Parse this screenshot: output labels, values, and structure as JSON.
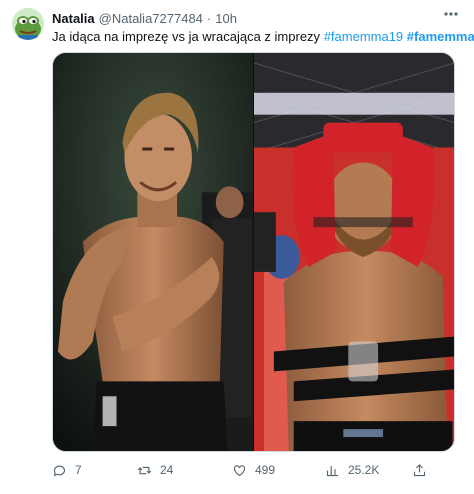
{
  "author": {
    "display_name": "Natalia",
    "handle": "@Natalia7277484",
    "separator": "·",
    "time": "10h",
    "avatar_icon": "pepe-frog-avatar"
  },
  "tweet": {
    "text": "Ja idąca na imprezę vs ja wracająca z imprezy",
    "hashtags": [
      "#famemma19",
      "#famemma"
    ]
  },
  "media": {
    "left_image": "shirtless-fighter-celebrating",
    "right_image": "fighter-on-stretcher-with-neck-brace"
  },
  "actions": {
    "reply": {
      "icon": "reply-icon",
      "count": "7"
    },
    "retweet": {
      "icon": "retweet-icon",
      "count": "24"
    },
    "like": {
      "icon": "like-icon",
      "count": "499"
    },
    "views": {
      "icon": "views-icon",
      "count": "25.2K"
    },
    "share": {
      "icon": "share-icon"
    }
  },
  "colors": {
    "hashtag": "#1d9bf0",
    "secondary_text": "#536471",
    "border": "#cfd9de",
    "stretcher_red": "#d2232a"
  }
}
